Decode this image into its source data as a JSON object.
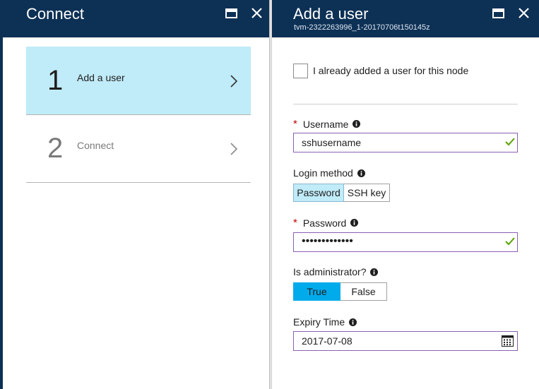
{
  "left_blade": {
    "title": "Connect",
    "steps": [
      {
        "number": "1",
        "label": "Add a user"
      },
      {
        "number": "2",
        "label": "Connect"
      }
    ]
  },
  "right_blade": {
    "title": "Add a user",
    "subtitle": "tvm-2322263996_1-20170706t150145z",
    "already_added_label": "I already added a user for this node",
    "username": {
      "required_mark": "*",
      "label": "Username",
      "value": "sshusername"
    },
    "login_method": {
      "label": "Login method",
      "options": [
        "Password",
        "SSH key"
      ],
      "selected": "Password"
    },
    "password": {
      "required_mark": "*",
      "label": "Password",
      "masked_value": "•••••••••••••"
    },
    "is_admin": {
      "label": "Is administrator?",
      "options": [
        "True",
        "False"
      ],
      "selected": "True"
    },
    "expiry": {
      "label": "Expiry Time",
      "value": "2017-07-08"
    }
  },
  "icons": {
    "maximize": "maximize-icon",
    "close": "close-icon",
    "chevron": "chevron-right-icon",
    "info": "info-icon",
    "valid": "checkmark-icon",
    "calendar": "calendar-icon"
  },
  "colors": {
    "header_bg": "#0d3055",
    "active_step_bg": "#c0ebf8",
    "selected_toggle": "#00abec",
    "input_border": "#8a5fb4",
    "valid_check": "#57a300",
    "required": "#c00000"
  }
}
